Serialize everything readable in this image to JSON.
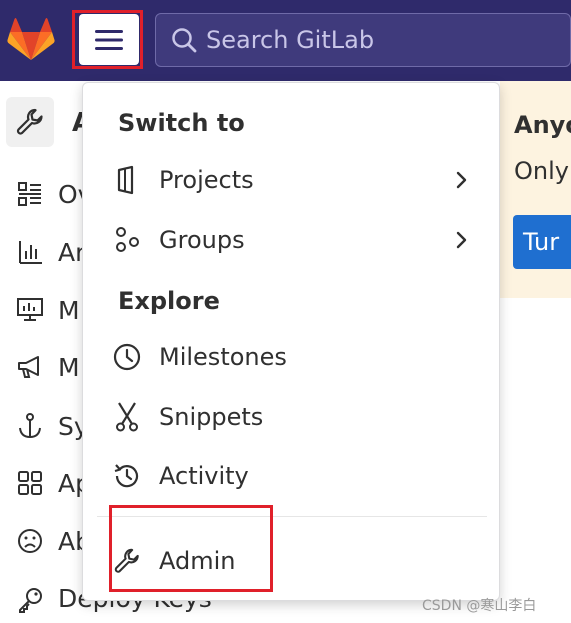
{
  "colors": {
    "topbar": "#2f2a6b",
    "highlight": "#e0202a",
    "banner_bg": "#fdf3e0",
    "primary_button": "#1f6fd0",
    "gitlab_orange": "#e24329"
  },
  "header": {
    "search_placeholder": "Search GitLab",
    "menu_icon": "hamburger-icon",
    "logo_icon": "gitlab-logo"
  },
  "sidebar": {
    "head_label": "A",
    "items": [
      {
        "label": "Ov",
        "icon": "overview-icon"
      },
      {
        "label": "An",
        "icon": "analytics-icon"
      },
      {
        "label": "M",
        "icon": "monitor-icon"
      },
      {
        "label": "M",
        "icon": "megaphone-icon"
      },
      {
        "label": "Sy",
        "icon": "anchor-icon"
      },
      {
        "label": "Ap",
        "icon": "apps-icon"
      },
      {
        "label": "Ab",
        "icon": "abuse-icon"
      },
      {
        "label": "Deploy Keys",
        "icon": "key-icon"
      }
    ]
  },
  "banner": {
    "title": "Anyo",
    "text": "Only",
    "button_label": "Tur"
  },
  "menu": {
    "switch_heading": "Switch to",
    "projects_label": "Projects",
    "groups_label": "Groups",
    "explore_heading": "Explore",
    "milestones_label": "Milestones",
    "snippets_label": "Snippets",
    "activity_label": "Activity",
    "admin_label": "Admin"
  },
  "watermark": "CSDN @寒山李白"
}
